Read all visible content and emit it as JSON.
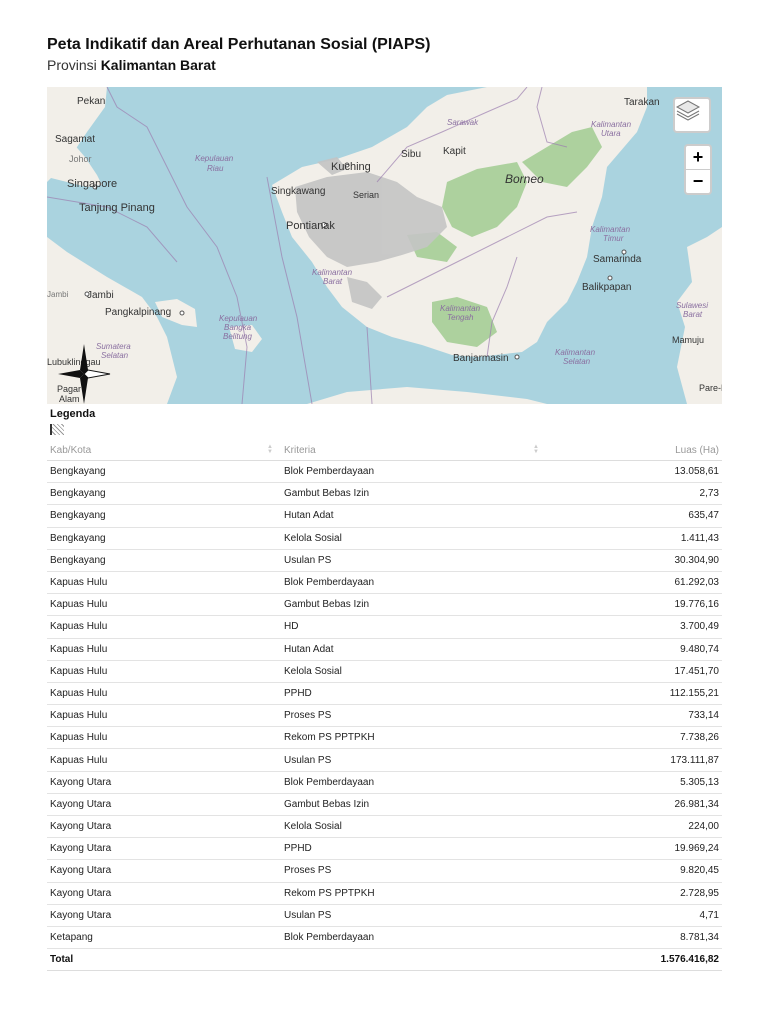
{
  "header": {
    "title": "Peta Indikatif dan Areal Perhutanan Sosial (PIAPS)",
    "province_prefix": "Provinsi",
    "province_name": "Kalimantan Barat"
  },
  "map": {
    "labels": {
      "pekan": "Pekan",
      "tarakan": "Tarakan",
      "sagamat": "Sagamat",
      "johor": "Johor",
      "singapore": "Singapore",
      "tanjung_pinang": "Tanjung Pinang",
      "kepulauan_riau_1": "Kepulauan",
      "kepulauan_riau_2": "Riau",
      "kuching": "Kuching",
      "sarawak": "Sarawak",
      "sibu": "Sibu",
      "kapit": "Kapit",
      "borneo": "Borneo",
      "kaltara_1": "Kalimantan",
      "kaltara_2": "Utara",
      "singkawang": "Singkawang",
      "serian": "Serian",
      "pontianak": "Pontianak",
      "kalbar_1": "Kalimantan",
      "kalbar_2": "Barat",
      "kaltim_1": "Kalimantan",
      "kaltim_2": "Timur",
      "samarinda": "Samarinda",
      "balikpapan": "Balikpapan",
      "jambi": "Jambi",
      "pangkalpinang": "Pangkalpinang",
      "babel_1": "Kepulauan",
      "babel_2": "Bangka",
      "babel_3": "Belitung",
      "kalteng_1": "Kalimantan",
      "kalteng_2": "Tengah",
      "sulbar_1": "Sulawesi",
      "sulbar_2": "Barat",
      "mamuju": "Mamuju",
      "sumsel_1": "Sumatera",
      "sumsel_2": "Selatan",
      "lubuklinggau": "Lubuklinggau",
      "pagar_alam_1": "Pagar",
      "pagar_alam_2": "Alam",
      "banjarmasin": "Banjarmasin",
      "kalsel_1": "Kalimantan",
      "kalsel_2": "Selatan",
      "parepare": "Pare-P",
      "jambi_left": "Jambi"
    },
    "zoom_in": "+",
    "zoom_out": "−",
    "colors": {
      "sea": "#aad3df",
      "land": "#f2efe9",
      "forest": "#add19e",
      "piaps": "#b8b8b8"
    }
  },
  "legend": {
    "title": "Legenda"
  },
  "table": {
    "headers": {
      "kab": "Kab/Kota",
      "kriteria": "Kriteria",
      "luas": "Luas (Ha)"
    },
    "rows": [
      {
        "kab": "Bengkayang",
        "kriteria": "Blok Pemberdayaan",
        "luas": "13.058,61"
      },
      {
        "kab": "Bengkayang",
        "kriteria": "Gambut Bebas Izin",
        "luas": "2,73"
      },
      {
        "kab": "Bengkayang",
        "kriteria": "Hutan Adat",
        "luas": "635,47"
      },
      {
        "kab": "Bengkayang",
        "kriteria": "Kelola Sosial",
        "luas": "1.411,43"
      },
      {
        "kab": "Bengkayang",
        "kriteria": "Usulan PS",
        "luas": "30.304,90"
      },
      {
        "kab": "Kapuas Hulu",
        "kriteria": "Blok Pemberdayaan",
        "luas": "61.292,03"
      },
      {
        "kab": "Kapuas Hulu",
        "kriteria": "Gambut Bebas Izin",
        "luas": "19.776,16"
      },
      {
        "kab": "Kapuas Hulu",
        "kriteria": "HD",
        "luas": "3.700,49"
      },
      {
        "kab": "Kapuas Hulu",
        "kriteria": "Hutan Adat",
        "luas": "9.480,74"
      },
      {
        "kab": "Kapuas Hulu",
        "kriteria": "Kelola Sosial",
        "luas": "17.451,70"
      },
      {
        "kab": "Kapuas Hulu",
        "kriteria": "PPHD",
        "luas": "112.155,21"
      },
      {
        "kab": "Kapuas Hulu",
        "kriteria": "Proses PS",
        "luas": "733,14"
      },
      {
        "kab": "Kapuas Hulu",
        "kriteria": "Rekom PS PPTPKH",
        "luas": "7.738,26"
      },
      {
        "kab": "Kapuas Hulu",
        "kriteria": "Usulan PS",
        "luas": "173.111,87"
      },
      {
        "kab": "Kayong Utara",
        "kriteria": "Blok Pemberdayaan",
        "luas": "5.305,13"
      },
      {
        "kab": "Kayong Utara",
        "kriteria": "Gambut Bebas Izin",
        "luas": "26.981,34"
      },
      {
        "kab": "Kayong Utara",
        "kriteria": "Kelola Sosial",
        "luas": "224,00"
      },
      {
        "kab": "Kayong Utara",
        "kriteria": "PPHD",
        "luas": "19.969,24"
      },
      {
        "kab": "Kayong Utara",
        "kriteria": "Proses PS",
        "luas": "9.820,45"
      },
      {
        "kab": "Kayong Utara",
        "kriteria": "Rekom PS PPTPKH",
        "luas": "2.728,95"
      },
      {
        "kab": "Kayong Utara",
        "kriteria": "Usulan PS",
        "luas": "4,71"
      },
      {
        "kab": "Ketapang",
        "kriteria": "Blok Pemberdayaan",
        "luas": "8.781,34"
      }
    ],
    "total": {
      "label": "Total",
      "luas": "1.576.416,82"
    }
  }
}
